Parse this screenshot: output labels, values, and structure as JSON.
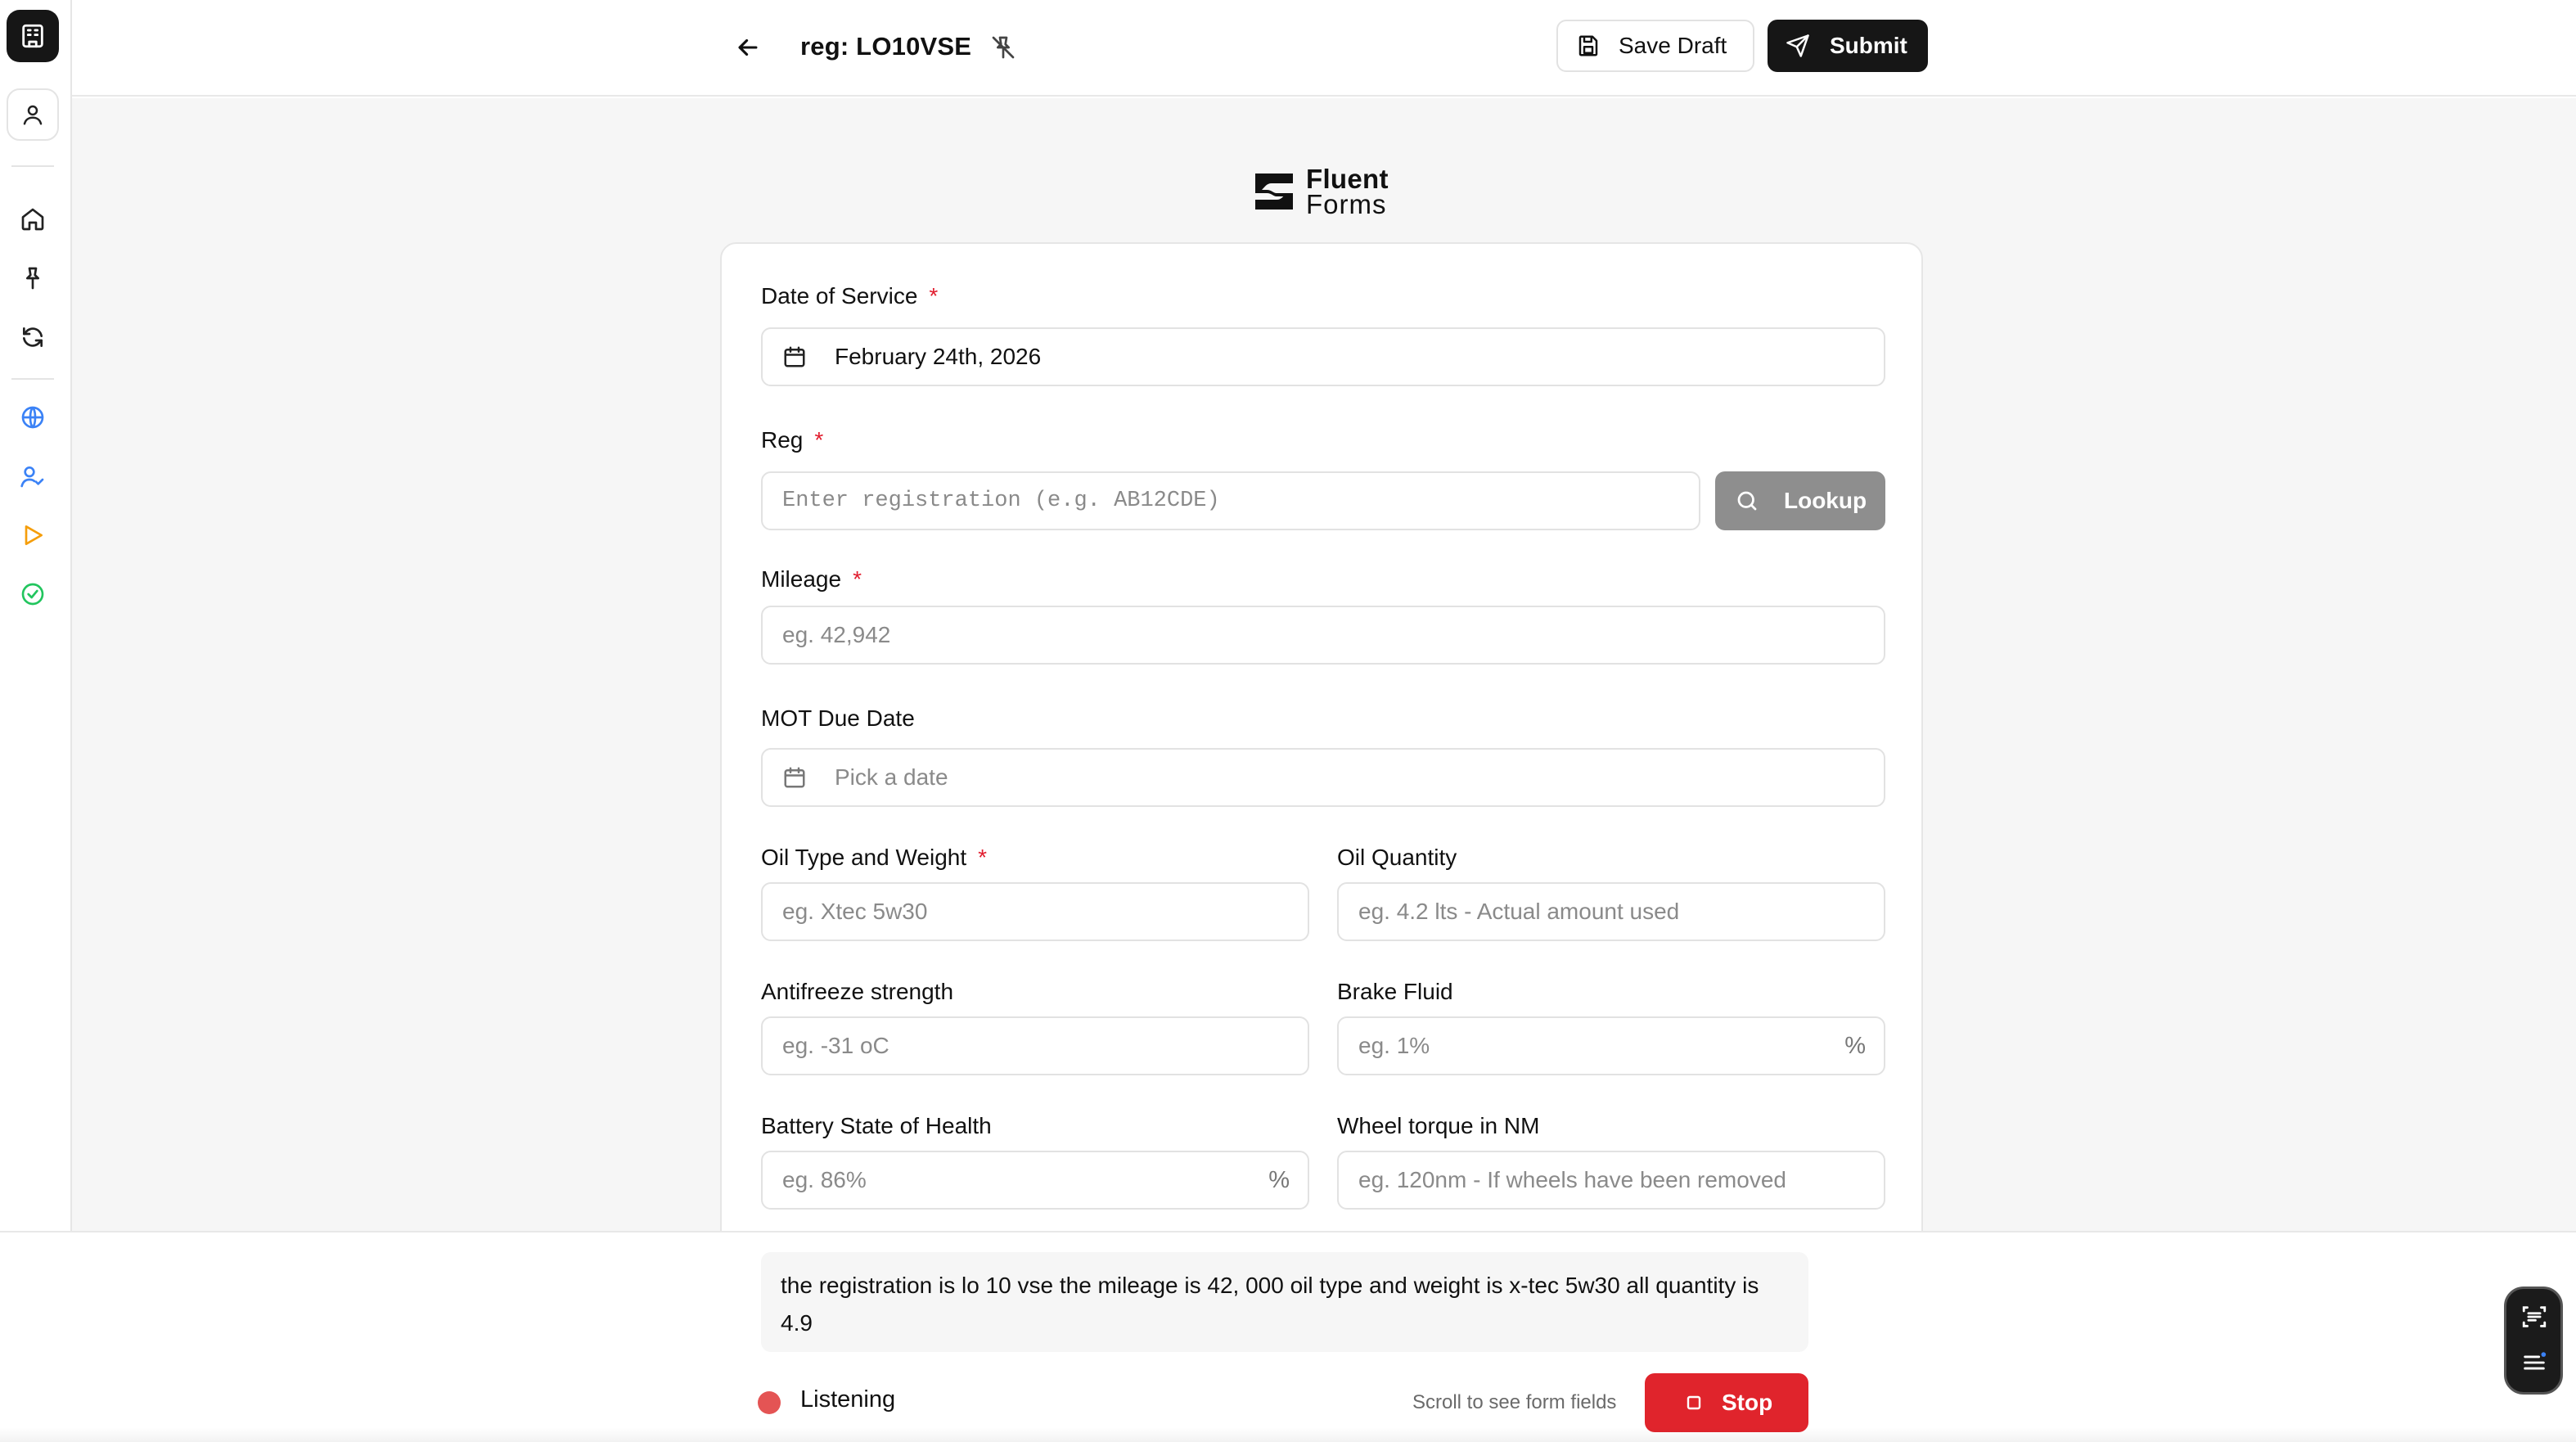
{
  "header": {
    "title": "reg: LO10VSE",
    "save_draft_label": "Save Draft",
    "submit_label": "Submit"
  },
  "brand": {
    "line1": "Fluent",
    "line2": "Forms"
  },
  "form": {
    "date_of_service": {
      "label": "Date of Service",
      "required": "*",
      "value": "February 24th, 2026"
    },
    "reg": {
      "label": "Reg",
      "required": "*",
      "placeholder": "Enter registration (e.g. AB12CDE)",
      "lookup_label": "Lookup"
    },
    "mileage": {
      "label": "Mileage",
      "required": "*",
      "placeholder": "eg. 42,942"
    },
    "mot_due_date": {
      "label": "MOT Due Date",
      "placeholder": "Pick a date"
    },
    "oil_type": {
      "label": "Oil Type and Weight",
      "required": "*",
      "placeholder": "eg. Xtec 5w30"
    },
    "oil_quantity": {
      "label": "Oil Quantity",
      "placeholder": "eg. 4.2 lts - Actual amount used"
    },
    "antifreeze": {
      "label": "Antifreeze strength",
      "placeholder": "eg. -31 oC"
    },
    "brake_fluid": {
      "label": "Brake Fluid",
      "placeholder": "eg. 1%",
      "suffix": "%"
    },
    "battery": {
      "label": "Battery State of Health",
      "placeholder": "eg. 86%",
      "suffix": "%"
    },
    "wheel_torque": {
      "label": "Wheel torque in NM",
      "placeholder": "eg. 120nm - If wheels have been removed"
    }
  },
  "voice": {
    "transcript": "the registration is lo 10 vse the mileage is 42, 000 oil type and weight is x-tec 5w30 all quantity is 4.9",
    "status": "Listening",
    "hint": "Scroll to see form fields",
    "stop_label": "Stop"
  },
  "colors": {
    "primary": "#161616",
    "required": "#e11d2e",
    "stop": "#e0242c",
    "listening_dot": "#e45454",
    "lookup_disabled": "#8e8e8e",
    "globe_icon": "#3b82f6",
    "users_icon": "#3b82f6",
    "play_icon": "#f59e0b",
    "check_icon": "#22c55e"
  },
  "icons": [
    "building-icon",
    "user-icon",
    "home-icon",
    "pin-icon",
    "refresh-icon",
    "globe-icon",
    "user-check-icon",
    "play-icon",
    "check-circle-icon",
    "arrow-left-icon",
    "pin-off-icon",
    "save-icon",
    "send-icon",
    "calendar-icon",
    "search-icon",
    "stop-icon",
    "scan-text-icon",
    "list-icon"
  ]
}
